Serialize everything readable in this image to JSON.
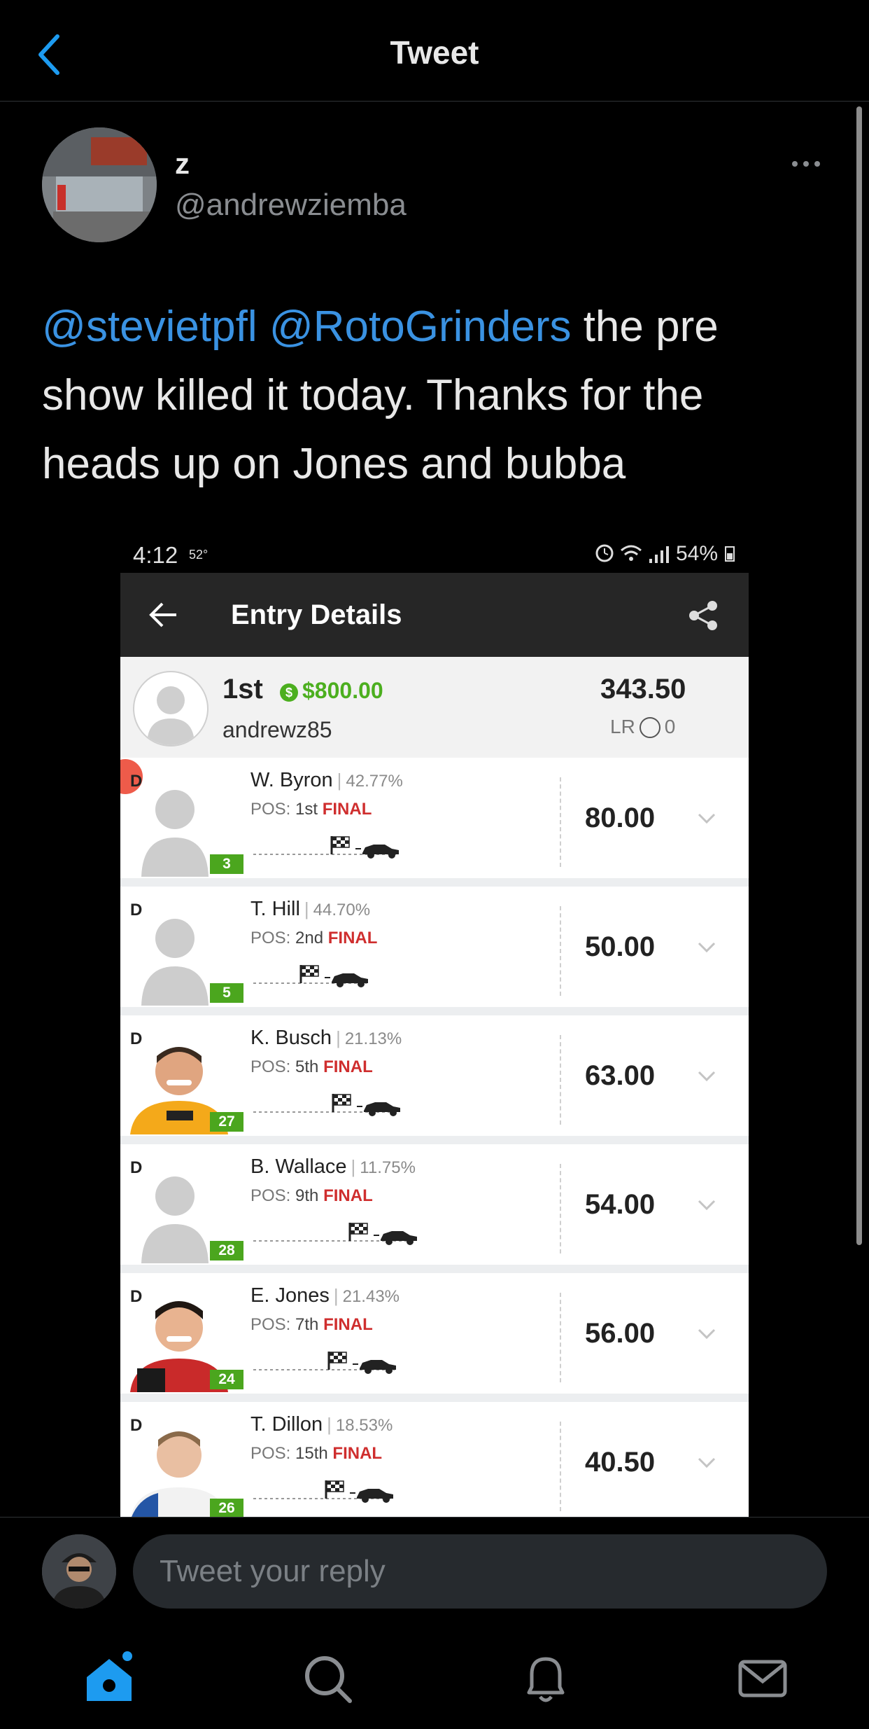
{
  "header": {
    "title": "Tweet"
  },
  "tweet": {
    "display_name": "z",
    "handle": "@andrewziemba",
    "mention_1": "@stevietpfl",
    "mention_2": "@RotoGrinders",
    "text_part_1": " the pre",
    "text_line_2": "show killed it today. Thanks for the",
    "text_line_3": "heads up on Jones and bubba"
  },
  "screenshot": {
    "status_time": "4:12",
    "status_temp": "52°",
    "status_battery": "54%",
    "app_title": "Entry Details",
    "summary": {
      "rank": "1st",
      "winnings": "$800.00",
      "username": "andrewz85",
      "points": "343.50",
      "lr_label": "LR",
      "lr_value": "0"
    },
    "players": [
      {
        "pos_tag": "D",
        "name": "W. Byron",
        "ownership": "42.77%",
        "pos_label": "POS:",
        "pos": "1st",
        "status": "FINAL",
        "number": "3",
        "score": "80.00",
        "photo": "silhouette"
      },
      {
        "pos_tag": "D",
        "name": "T. Hill",
        "ownership": "44.70%",
        "pos_label": "POS:",
        "pos": "2nd",
        "status": "FINAL",
        "number": "5",
        "score": "50.00",
        "photo": "silhouette"
      },
      {
        "pos_tag": "D",
        "name": "K. Busch",
        "ownership": "21.13%",
        "pos_label": "POS:",
        "pos": "5th",
        "status": "FINAL",
        "number": "27",
        "score": "63.00",
        "photo": "driver-yellow"
      },
      {
        "pos_tag": "D",
        "name": "B. Wallace",
        "ownership": "11.75%",
        "pos_label": "POS:",
        "pos": "9th",
        "status": "FINAL",
        "number": "28",
        "score": "54.00",
        "photo": "silhouette"
      },
      {
        "pos_tag": "D",
        "name": "E. Jones",
        "ownership": "21.43%",
        "pos_label": "POS:",
        "pos": "7th",
        "status": "FINAL",
        "number": "24",
        "score": "56.00",
        "photo": "driver-red"
      },
      {
        "pos_tag": "D",
        "name": "T. Dillon",
        "ownership": "18.53%",
        "pos_label": "POS:",
        "pos": "15th",
        "status": "FINAL",
        "number": "26",
        "score": "40.50",
        "photo": "driver-white"
      }
    ]
  },
  "reply": {
    "placeholder": "Tweet your reply"
  },
  "tabs": [
    "home",
    "search",
    "notifications",
    "messages"
  ],
  "colors": {
    "mention": "#3a92e2",
    "money": "#4caf1f",
    "final": "#cf2e2e",
    "badge": "#4ba61e",
    "tab_active": "#1d9bf0"
  }
}
